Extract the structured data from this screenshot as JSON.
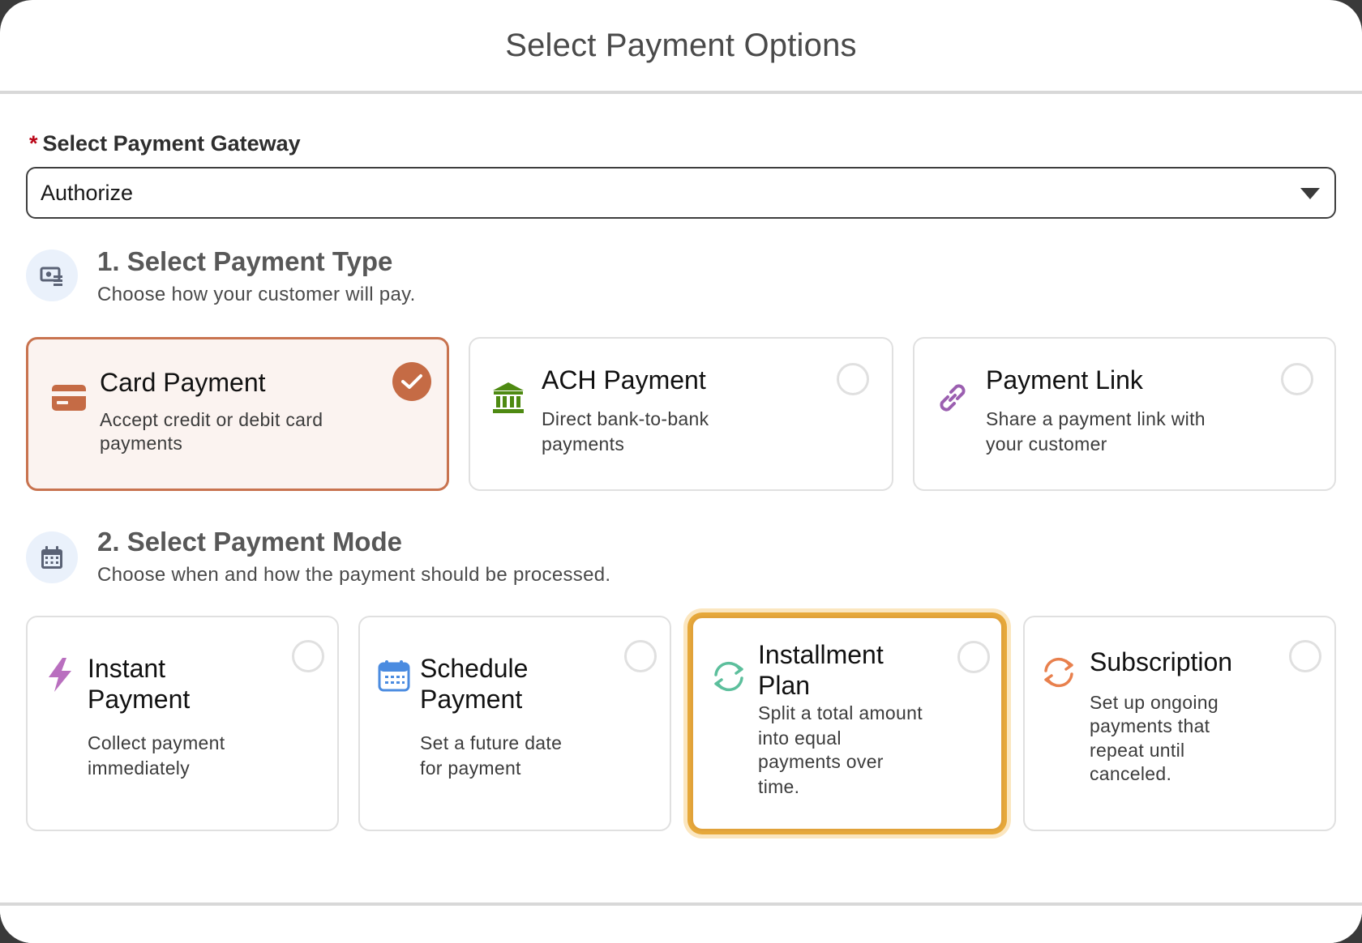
{
  "modal": {
    "title": "Select Payment Options"
  },
  "gateway": {
    "label": "Select Payment Gateway",
    "required_marker": "*",
    "selected": "Authorize"
  },
  "payment_type": {
    "title": "1. Select Payment Type",
    "subtitle": "Choose how your customer will pay.",
    "icon": "money-icon",
    "options": [
      {
        "title": "Card Payment",
        "desc1": "Accept credit or debit card",
        "desc2": "payments",
        "icon": "credit-card-icon",
        "selected": true
      },
      {
        "title": "ACH Payment",
        "desc1": "Direct bank-to-bank",
        "desc2": "payments",
        "icon": "bank-icon",
        "selected": false
      },
      {
        "title": "Payment Link",
        "desc1": "Share a payment link with",
        "desc2": "your customer",
        "icon": "link-icon",
        "selected": false
      }
    ]
  },
  "payment_mode": {
    "title": "2. Select Payment Mode",
    "subtitle": "Choose when and how the payment should be processed.",
    "icon": "calendar-icon",
    "options": [
      {
        "title1": "Instant",
        "title2": "Payment",
        "desc1": "Collect payment",
        "desc2": "immediately",
        "icon": "lightning-icon",
        "selected": false
      },
      {
        "title1": "Schedule",
        "title2": "Payment",
        "desc1": "Set a future date",
        "desc2": "for payment",
        "icon": "calendar-icon",
        "selected": false
      },
      {
        "title1": "Installment",
        "title2": "Plan",
        "desc1": "Split a total amount",
        "desc2": "into equal",
        "desc3": "payments over",
        "desc4": "time.",
        "icon": "refresh-icon",
        "selected": false
      },
      {
        "title1": "Subscription",
        "desc1": "Set up ongoing",
        "desc2": "payments that",
        "desc3": "repeat until",
        "desc4": "canceled.",
        "icon": "sync-icon",
        "selected": false
      }
    ]
  },
  "colors": {
    "selected_border": "#c8734f",
    "selected_bg": "#fbf3f0",
    "focus_ring": "#e6a83a",
    "required": "#ba0517"
  }
}
